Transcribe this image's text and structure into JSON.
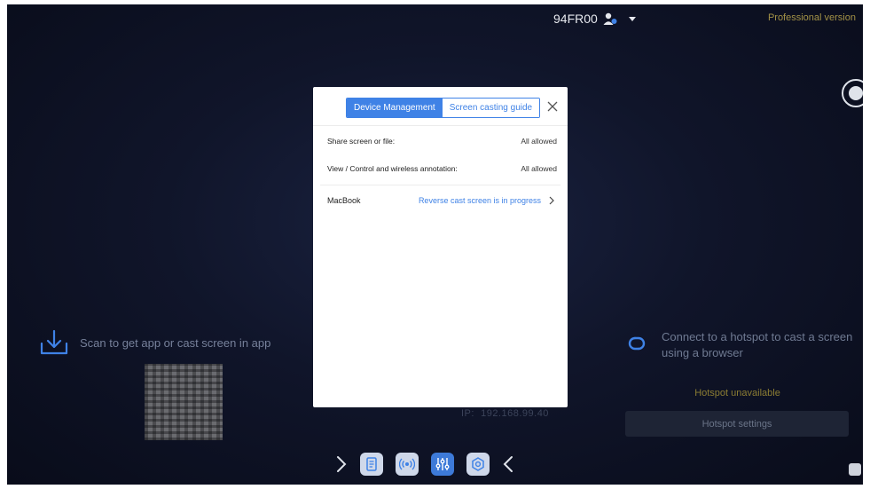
{
  "topbar": {
    "device_id": "94FR00",
    "version_label": "Professional version"
  },
  "left_panel": {
    "hint": "Scan to get app or cast screen in app"
  },
  "right_panel": {
    "hint": "Connect to a hotspot to cast a screen using a browser",
    "hotspot_status": "Hotspot unavailable",
    "hotspot_button": "Hotspot settings"
  },
  "ip_label": "IP:",
  "ip_value": "192.168.99.40",
  "dialog": {
    "tabs": [
      {
        "label": "Device Management",
        "active": true
      },
      {
        "label": "Screen casting guide",
        "active": false
      }
    ],
    "settings": [
      {
        "label": "Share screen or file:",
        "value": "All allowed"
      },
      {
        "label": "View / Control and wireless annotation:",
        "value": "All allowed"
      }
    ],
    "devices": [
      {
        "name": "MacBook",
        "status": "Reverse cast screen is in progress"
      }
    ]
  },
  "dock": {
    "icons": [
      "expand-right-icon",
      "document-icon",
      "broadcast-icon",
      "equalizer-icon",
      "settings-hex-icon",
      "collapse-left-icon"
    ],
    "active": "equalizer-icon"
  },
  "colors": {
    "accent": "#3f82e6",
    "background": "#10152a",
    "warning": "#c8b250"
  }
}
